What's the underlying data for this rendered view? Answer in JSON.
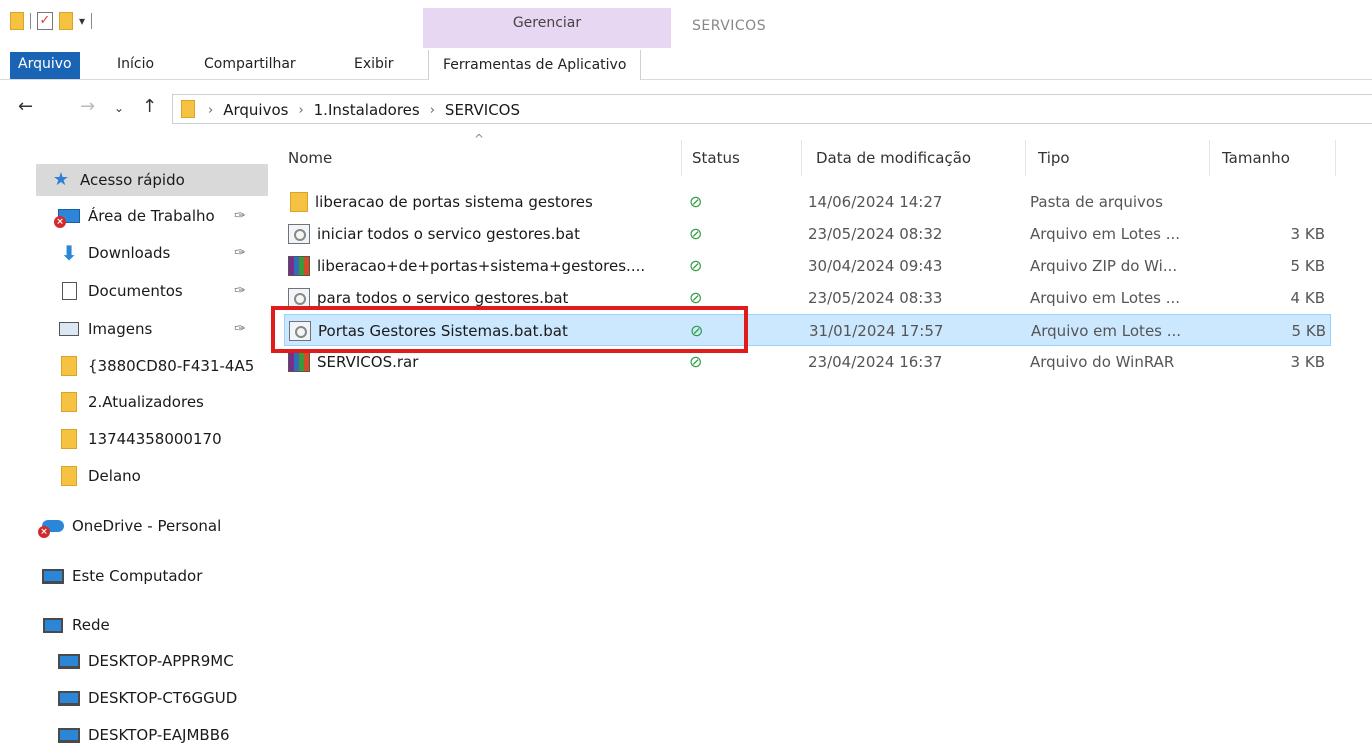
{
  "ribbon": {
    "contextual_group": "Gerenciar",
    "window_title": "SERVICOS",
    "tabs": [
      "Arquivo",
      "Início",
      "Compartilhar",
      "Exibir",
      "Ferramentas de Aplicativo"
    ]
  },
  "address": {
    "breadcrumbs": [
      "Arquivos",
      "1.Instaladores",
      "SERVICOS"
    ]
  },
  "nav": {
    "quick_access": "Acesso rápido",
    "items": [
      {
        "label": "Área de Trabalho",
        "icon": "desktop-icon",
        "pinned": true,
        "error": true
      },
      {
        "label": "Downloads",
        "icon": "downloads-icon",
        "pinned": true
      },
      {
        "label": "Documentos",
        "icon": "documents-icon",
        "pinned": true
      },
      {
        "label": "Imagens",
        "icon": "pictures-icon",
        "pinned": true
      },
      {
        "label": "{3880CD80-F431-4A5",
        "icon": "folder-icon"
      },
      {
        "label": "2.Atualizadores",
        "icon": "folder-icon"
      },
      {
        "label": "13744358000170",
        "icon": "folder-icon"
      },
      {
        "label": "Delano",
        "icon": "folder-icon"
      }
    ],
    "onedrive": "OneDrive - Personal",
    "this_pc": "Este Computador",
    "network": "Rede",
    "network_items": [
      "DESKTOP-APPR9MC",
      "DESKTOP-CT6GGUD",
      "DESKTOP-EAJMBB6"
    ]
  },
  "columns": [
    "Nome",
    "Status",
    "Data de modificação",
    "Tipo",
    "Tamanho"
  ],
  "files": [
    {
      "name": "liberacao de portas sistema gestores",
      "icon": "folder-icon",
      "status": "synced",
      "date": "14/06/2024 14:27",
      "type": "Pasta de arquivos",
      "size": ""
    },
    {
      "name": "iniciar todos o servico gestores.bat",
      "icon": "batch-file-icon",
      "status": "synced",
      "date": "23/05/2024 08:32",
      "type": "Arquivo em Lotes ...",
      "size": "3 KB"
    },
    {
      "name": "liberacao+de+portas+sistema+gestores....",
      "icon": "winrar-icon",
      "status": "synced",
      "date": "30/04/2024 09:43",
      "type": "Arquivo ZIP do Wi...",
      "size": "5 KB"
    },
    {
      "name": "para todos o servico gestores.bat",
      "icon": "batch-file-icon",
      "status": "synced",
      "date": "23/05/2024 08:33",
      "type": "Arquivo em Lotes ...",
      "size": "4 KB"
    },
    {
      "name": "Portas Gestores Sistemas.bat.bat",
      "icon": "batch-file-icon",
      "status": "synced",
      "date": "31/01/2024 17:57",
      "type": "Arquivo em Lotes ...",
      "size": "5 KB",
      "selected": true
    },
    {
      "name": "SERVICOS.rar",
      "icon": "winrar-icon",
      "status": "synced",
      "date": "23/04/2024 16:37",
      "type": "Arquivo do WinRAR",
      "size": "3 KB"
    }
  ],
  "colors": {
    "accent": "#1a64b5",
    "selection": "#cce8ff",
    "highlight": "#e01b1b",
    "status_ok": "#2f9e44"
  }
}
